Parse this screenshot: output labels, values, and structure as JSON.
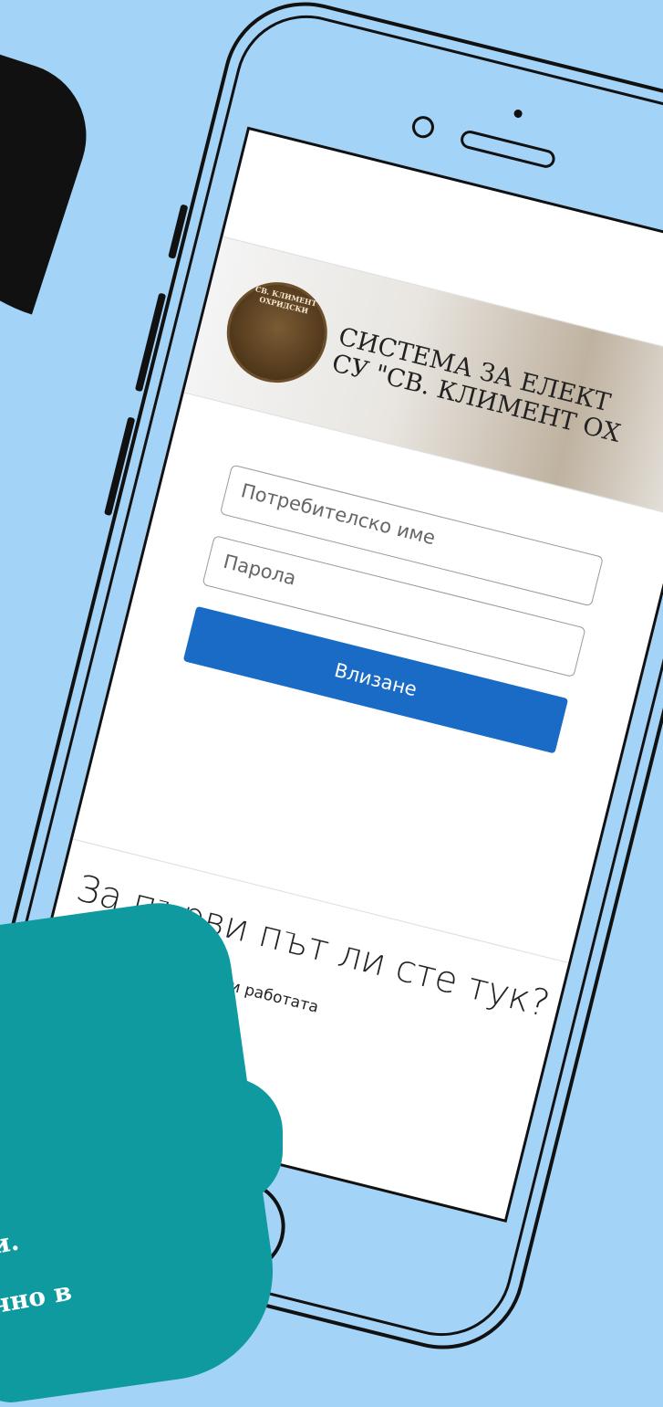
{
  "banner": {
    "seal_text": "СВ. КЛИМЕНТ ОХРИДСКИ",
    "title_line1": "СИСТЕМА ЗА ЕЛЕКТ",
    "title_line2": "СУ \"СВ. КЛИМЕНТ ОХ"
  },
  "login": {
    "username_placeholder": "Потребителско име",
    "password_placeholder": "Парола",
    "button_label": "Влизане"
  },
  "info": {
    "heading": "За първи път ли сте тук?",
    "text": "облеми с достъпа или работата"
  },
  "overlay": {
    "line1": "и.",
    "line2": "чно в"
  }
}
